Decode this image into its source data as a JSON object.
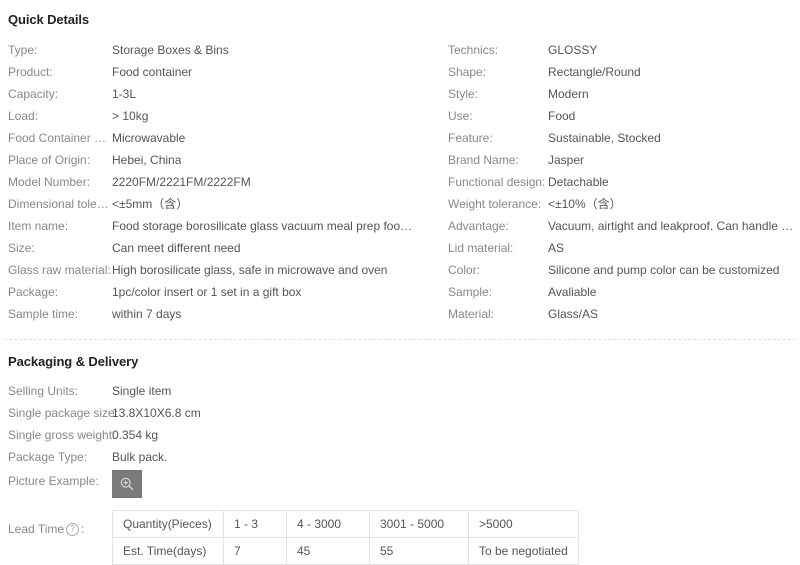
{
  "quick_details": {
    "title": "Quick Details",
    "left_specs": [
      {
        "label": "Type:",
        "value": "Storage Boxes & Bins"
      },
      {
        "label": "Product:",
        "value": "Food container"
      },
      {
        "label": "Capacity:",
        "value": "1-3L"
      },
      {
        "label": "Load:",
        "value": "> 10kg"
      },
      {
        "label": "Food Container Fea…",
        "value": "Microwavable"
      },
      {
        "label": "Place of Origin:",
        "value": "Hebei, China"
      },
      {
        "label": "Model Number:",
        "value": "2220FM/2221FM/2222FM"
      },
      {
        "label": "Dimensional tolera…",
        "value": "<±5mm（含）"
      },
      {
        "label": "Item name:",
        "value": "Food storage borosilicate glass vacuum meal prep food cont…"
      },
      {
        "label": "Size:",
        "value": "Can meet different need"
      },
      {
        "label": "Glass raw material:",
        "value": "High borosilicate glass, safe in microwave and oven"
      },
      {
        "label": "Package:",
        "value": "1pc/color insert or 1 set in a gift box"
      },
      {
        "label": "Sample time:",
        "value": "within 7 days"
      }
    ],
    "right_specs": [
      {
        "label": "Technics:",
        "value": "GLOSSY"
      },
      {
        "label": "Shape:",
        "value": "Rectangle/Round"
      },
      {
        "label": "Style:",
        "value": "Modern"
      },
      {
        "label": "Use:",
        "value": "Food"
      },
      {
        "label": "Feature:",
        "value": "Sustainable, Stocked"
      },
      {
        "label": "Brand Name:",
        "value": "Jasper"
      },
      {
        "label": "Functional design:",
        "value": "Detachable"
      },
      {
        "label": "Weight tolerance:",
        "value": "<±10%（含）"
      },
      {
        "label": "Advantage:",
        "value": "Vacuum, airtight and leakproof. Can handle soup"
      },
      {
        "label": "Lid material:",
        "value": "AS"
      },
      {
        "label": "Color:",
        "value": "Silicone and pump color can be customized"
      },
      {
        "label": "Sample:",
        "value": "Avaliable"
      },
      {
        "label": "Material:",
        "value": "Glass/AS"
      }
    ]
  },
  "packaging": {
    "title": "Packaging & Delivery",
    "rows": [
      {
        "label": "Selling Units:",
        "value": "Single item"
      },
      {
        "label": "Single package size:",
        "value": "13.8X10X6.8 cm"
      },
      {
        "label": "Single gross weight:",
        "value": "0.354 kg"
      },
      {
        "label": "Package Type:",
        "value": "Bulk pack."
      }
    ],
    "picture_example": {
      "label": "Picture Example:",
      "thumb_icon": "zoom-in-icon"
    },
    "lead_time": {
      "label": "Lead Time",
      "help_icon": "help-question-icon",
      "colon": ":",
      "table": {
        "row_headers": [
          "Quantity(Pieces)",
          "Est. Time(days)"
        ],
        "quantity_cells": [
          "1 - 3",
          "4 - 3000",
          "3001 - 5000",
          ">5000"
        ],
        "time_cells": [
          "7",
          "45",
          "55",
          "To be negotiated"
        ]
      }
    }
  },
  "colors": {
    "label": "#888888",
    "value": "#555555",
    "heading": "#222222",
    "divider": "#e0e0e0",
    "table_border": "#e3e3e3",
    "thumb_bg": "#7a7a7a"
  }
}
